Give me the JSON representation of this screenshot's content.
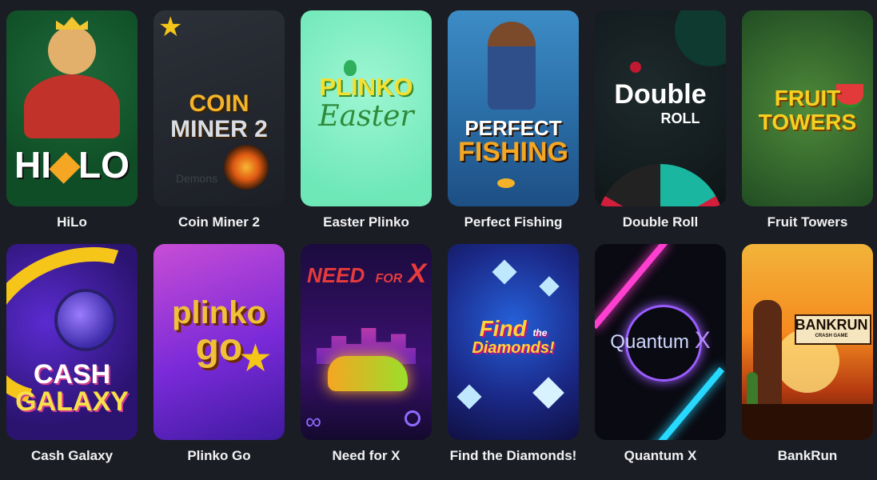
{
  "games": [
    {
      "title": "HiLo",
      "logo_lines": [
        "HI",
        "LO"
      ]
    },
    {
      "title": "Coin Miner 2",
      "logo_lines": [
        "COIN",
        "MINER 2"
      ],
      "watermark": "Demons"
    },
    {
      "title": "Easter Plinko",
      "logo_lines": [
        "PLINKO",
        "Easter"
      ]
    },
    {
      "title": "Perfect Fishing",
      "logo_lines": [
        "PERFECT",
        "FISHING"
      ]
    },
    {
      "title": "Double Roll",
      "logo_lines": [
        "Double",
        "ROLL"
      ]
    },
    {
      "title": "Fruit Towers",
      "logo_lines": [
        "FRUIT",
        "TOWERS"
      ]
    },
    {
      "title": "Cash Galaxy",
      "logo_lines": [
        "CASH",
        "GALAXY"
      ]
    },
    {
      "title": "Plinko Go",
      "logo_lines": [
        "plinko",
        "go"
      ]
    },
    {
      "title": "Need for X",
      "logo_lines": [
        "NEED",
        "FOR",
        "X"
      ]
    },
    {
      "title": "Find the Diamonds!",
      "logo_lines": [
        "Find",
        "the",
        "Diamonds!"
      ]
    },
    {
      "title": "Quantum X",
      "logo_lines": [
        "Quantum",
        "X"
      ]
    },
    {
      "title": "BankRun",
      "logo_lines": [
        "BANK",
        "RUN",
        "CRASH GAME"
      ]
    }
  ]
}
